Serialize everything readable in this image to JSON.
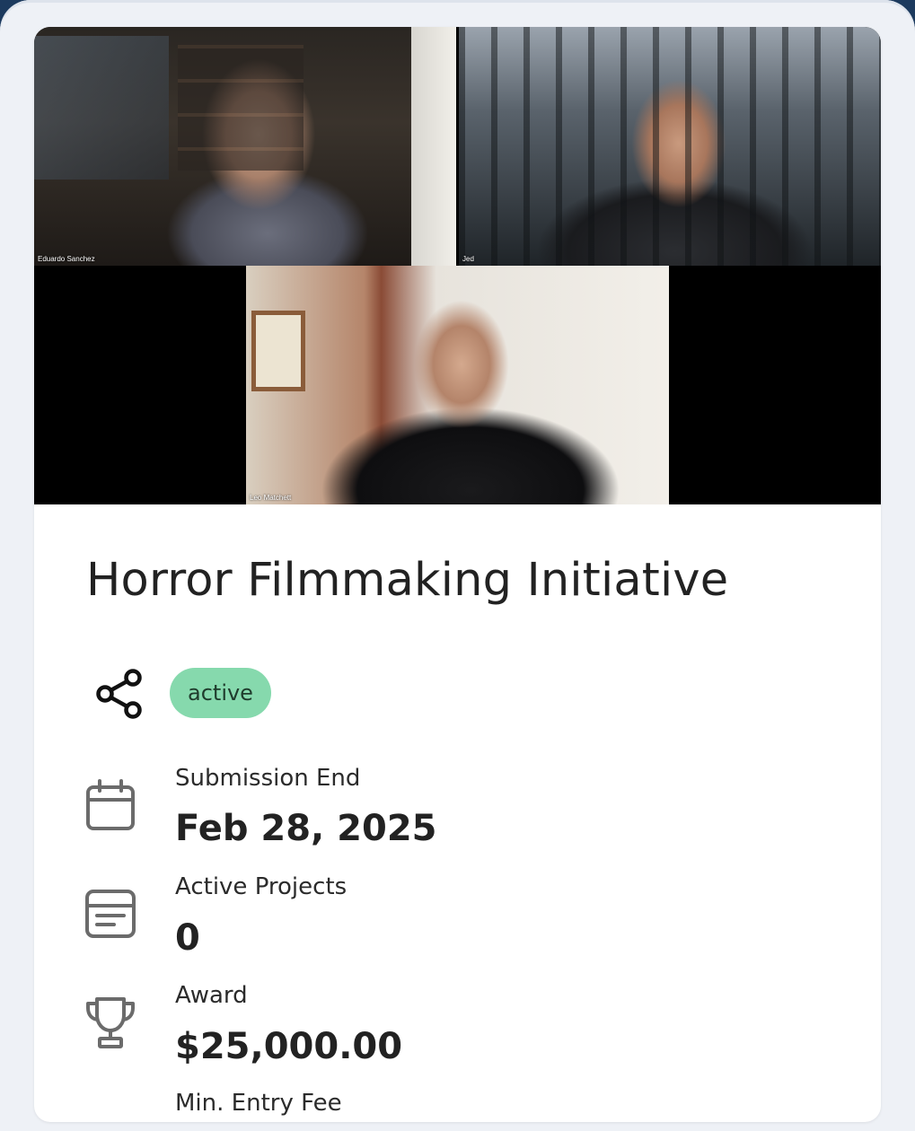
{
  "video_call": {
    "participants": [
      {
        "name": "Eduardo Sanchez"
      },
      {
        "name": "Jed"
      },
      {
        "name": "Leo Matchett"
      }
    ]
  },
  "initiative": {
    "title": "Horror Filmmaking Initiative",
    "status": "active",
    "share_icon": "share-icon"
  },
  "stats": [
    {
      "label": "Submission End",
      "value": "Feb 28, 2025",
      "icon": "calendar-icon"
    },
    {
      "label": "Active Projects",
      "value": "0",
      "icon": "list-card-icon"
    },
    {
      "label": "Award",
      "value": "$25,000.00",
      "icon": "trophy-icon"
    },
    {
      "label": "Min. Entry Fee",
      "value": "",
      "icon": ""
    }
  ],
  "colors": {
    "status_badge_bg": "#86d9ad",
    "card_bg": "#ffffff",
    "page_bg": "#eef1f6",
    "frame": "#1c3a5e"
  }
}
